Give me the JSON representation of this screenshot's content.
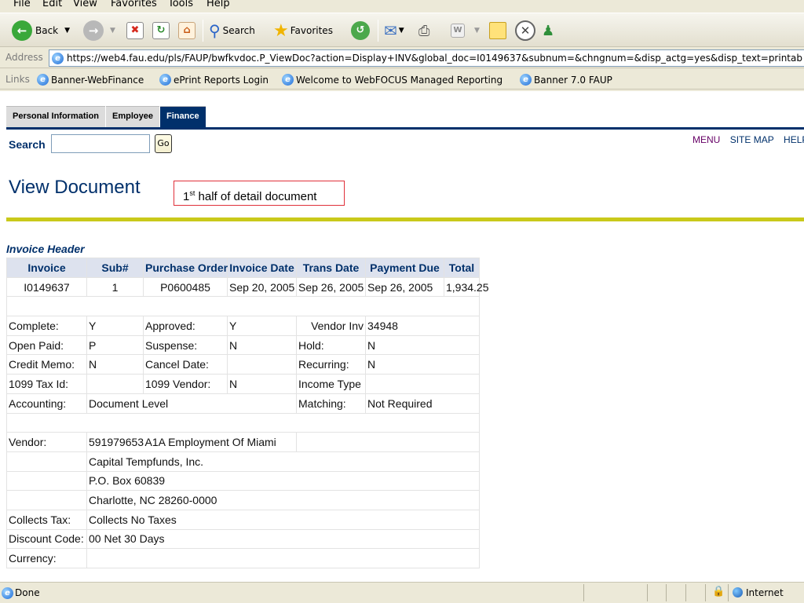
{
  "menu": [
    "File",
    "Edit",
    "View",
    "Favorites",
    "Tools",
    "Help"
  ],
  "toolbar": {
    "back_label": "Back",
    "search_label": "Search",
    "favorites_label": "Favorites"
  },
  "address": {
    "label": "Address",
    "url": "https://web4.fau.edu/pls/FAUP/bwfkvdoc.P_ViewDoc?action=Display+INV&global_doc=I0149637&subnum=&chngnum=&disp_actg=yes&disp_text=printab"
  },
  "links": {
    "label": "Links",
    "items": [
      "Banner-WebFinance",
      "ePrint Reports Login",
      "Welcome to WebFOCUS Managed Reporting",
      "Banner 7.0 FAUP"
    ]
  },
  "tabs": [
    "Personal Information",
    "Employee",
    "Finance"
  ],
  "search": {
    "label": "Search",
    "go_label": "Go"
  },
  "top_links": [
    "MENU",
    "SITE MAP",
    "HELP"
  ],
  "page_title": "View Document",
  "callout": {
    "num": "1",
    "sup": "st",
    "text": " half of detail document"
  },
  "invoice_header": {
    "title": "Invoice Header",
    "columns": [
      "Invoice",
      "Sub#",
      "Purchase Order",
      "Invoice Date",
      "Trans Date",
      "Payment Due",
      "Total"
    ],
    "row": [
      "I0149637",
      "1",
      "P0600485",
      "Sep 20, 2005",
      "Sep 26, 2005",
      "Sep 26, 2005",
      "1,934.25"
    ]
  },
  "details": {
    "complete_label": "Complete:",
    "complete": "Y",
    "approved_label": "Approved:",
    "approved": "Y",
    "vendor_inv_label": "Vendor Inv",
    "vendor_inv": "34948",
    "open_paid_label": "Open Paid:",
    "open_paid": "P",
    "suspense_label": "Suspense:",
    "suspense": "N",
    "hold_label": "Hold:",
    "hold": "N",
    "credit_memo_label": "Credit Memo:",
    "credit_memo": "N",
    "cancel_date_label": "Cancel Date:",
    "cancel_date": "",
    "recurring_label": "Recurring:",
    "recurring": "N",
    "tax_id_label": "1099 Tax Id:",
    "tax_id": "",
    "vendor_1099_label": "1099 Vendor:",
    "vendor_1099": "N",
    "income_type_label": "Income Type",
    "income_type": "",
    "accounting_label": "Accounting:",
    "accounting": "Document Level",
    "matching_label": "Matching:",
    "matching": "Not Required"
  },
  "vendor": {
    "label": "Vendor:",
    "id": "591979653",
    "name": "A1A Employment Of Miami",
    "address": [
      "Capital Tempfunds, Inc.",
      "P.O. Box 60839",
      "Charlotte, NC 28260-0000"
    ],
    "collects_tax_label": "Collects Tax:",
    "collects_tax": "Collects No Taxes",
    "discount_code_label": "Discount Code:",
    "discount_code": "00 Net 30 Days",
    "currency_label": "Currency:",
    "currency": ""
  },
  "status": {
    "text": "Done",
    "zone": "Internet"
  }
}
